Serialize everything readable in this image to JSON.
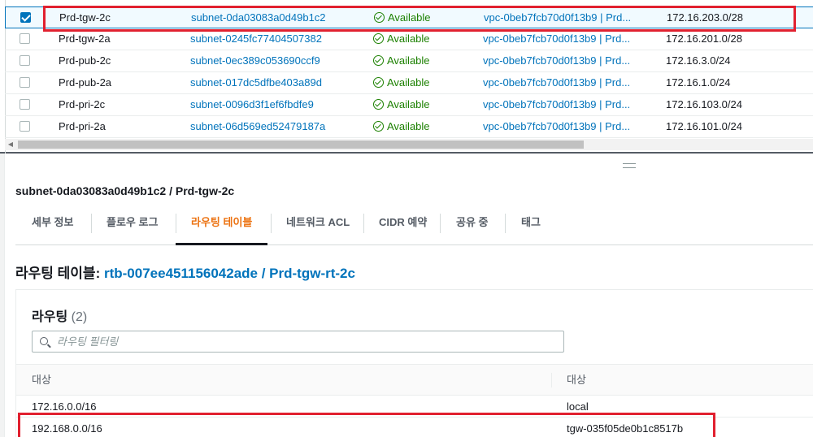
{
  "subnets": {
    "rows": [
      {
        "name": "Prd-tgw-2c",
        "subnet_id": "subnet-0da03083a0d49b1c2",
        "state": "Available",
        "vpc": "vpc-0beb7fcb70d0f13b9 | Prd...",
        "cidr": "172.16.203.0/28",
        "selected": true
      },
      {
        "name": "Prd-tgw-2a",
        "subnet_id": "subnet-0245fc77404507382",
        "state": "Available",
        "vpc": "vpc-0beb7fcb70d0f13b9 | Prd...",
        "cidr": "172.16.201.0/28",
        "selected": false
      },
      {
        "name": "Prd-pub-2c",
        "subnet_id": "subnet-0ec389c053690ccf9",
        "state": "Available",
        "vpc": "vpc-0beb7fcb70d0f13b9 | Prd...",
        "cidr": "172.16.3.0/24",
        "selected": false
      },
      {
        "name": "Prd-pub-2a",
        "subnet_id": "subnet-017dc5dfbe403a89d",
        "state": "Available",
        "vpc": "vpc-0beb7fcb70d0f13b9 | Prd...",
        "cidr": "172.16.1.0/24",
        "selected": false
      },
      {
        "name": "Prd-pri-2c",
        "subnet_id": "subnet-0096d3f1ef6fbdfe9",
        "state": "Available",
        "vpc": "vpc-0beb7fcb70d0f13b9 | Prd...",
        "cidr": "172.16.103.0/24",
        "selected": false
      },
      {
        "name": "Prd-pri-2a",
        "subnet_id": "subnet-06d569ed52479187a",
        "state": "Available",
        "vpc": "vpc-0beb7fcb70d0f13b9 | Prd...",
        "cidr": "172.16.101.0/24",
        "selected": false
      }
    ]
  },
  "detail": {
    "title": "subnet-0da03083a0d49b1c2 / Prd-tgw-2c",
    "tabs": [
      {
        "label": "세부 정보",
        "active": false
      },
      {
        "label": "플로우 로그",
        "active": false
      },
      {
        "label": "라우팅 테이블",
        "active": true
      },
      {
        "label": "네트워크 ACL",
        "active": false
      },
      {
        "label": "CIDR 예약",
        "active": false
      },
      {
        "label": "공유 중",
        "active": false
      },
      {
        "label": "태그",
        "active": false
      }
    ],
    "route_table_label": "라우팅 테이블:",
    "route_table_link": "rtb-007ee451156042ade / Prd-tgw-rt-2c"
  },
  "routes": {
    "title": "라우팅",
    "count": "(2)",
    "filter_placeholder": "라우팅 필터링",
    "columns": [
      "대상",
      "대상"
    ],
    "rows": [
      {
        "destination": "172.16.0.0/16",
        "target": "local"
      },
      {
        "destination": "192.168.0.0/16",
        "target": "tgw-035f05de0b1c8517b"
      }
    ]
  },
  "colors": {
    "link": "#0073bb",
    "available": "#1d8102",
    "active_tab": "#ec7211",
    "highlight": "#e1202f"
  }
}
